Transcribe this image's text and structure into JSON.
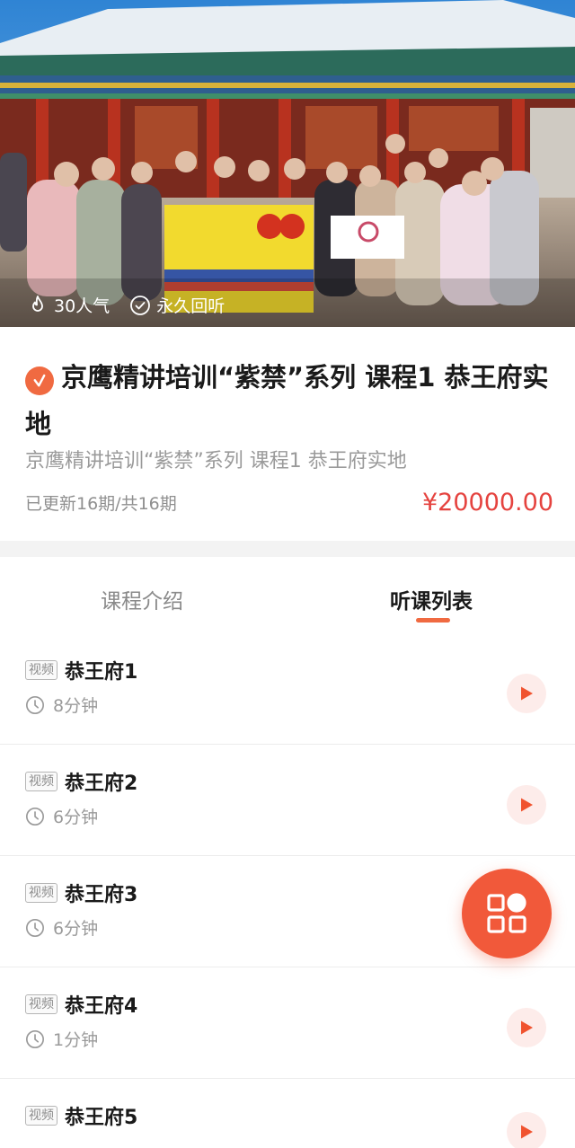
{
  "hero": {
    "popularity_text": "30人气",
    "replay_text": "永久回听",
    "popularity_icon": "flame-icon",
    "replay_icon": "check-circle-icon"
  },
  "course": {
    "title": "京鹰精讲培训“紫禁”系列 课程1 恭王府实地",
    "subtitle": "京鹰精讲培训“紫禁”系列 课程1 恭王府实地",
    "updates": "已更新16期/共16期",
    "price": "¥20000.00",
    "badge_icon": "verified-check-icon"
  },
  "tabs": [
    {
      "label": "课程介绍",
      "active": false
    },
    {
      "label": "听课列表",
      "active": true
    }
  ],
  "lessons": [
    {
      "type": "视频",
      "title": "恭王府1",
      "duration": "8分钟"
    },
    {
      "type": "视频",
      "title": "恭王府2",
      "duration": "6分钟"
    },
    {
      "type": "视频",
      "title": "恭王府3",
      "duration": "6分钟"
    },
    {
      "type": "视频",
      "title": "恭王府4",
      "duration": "1分钟"
    },
    {
      "type": "视频",
      "title": "恭王府5",
      "duration": ""
    }
  ],
  "fab": {
    "icon": "grid-apps-icon"
  },
  "colors": {
    "accent": "#f06a41",
    "price": "#e5433f",
    "fab": "#f1593a",
    "play_bg": "#fdecea"
  }
}
